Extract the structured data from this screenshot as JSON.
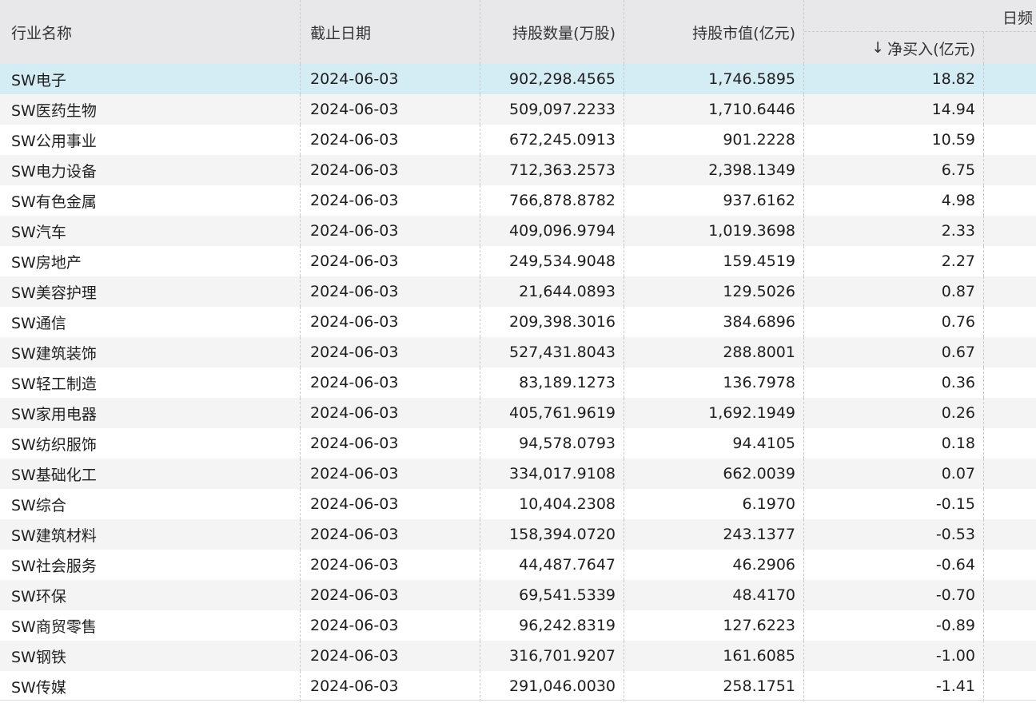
{
  "header": {
    "industry": "行业名称",
    "date": "截止日期",
    "shares": "持股数量(万股)",
    "value": "持股市值(亿元)",
    "group_title": "日频",
    "net_buy": "净买入(亿元)",
    "sort_icon": "↓"
  },
  "rows": [
    {
      "industry": "SW电子",
      "date": "2024-06-03",
      "shares": "902,298.4565",
      "value": "1,746.5895",
      "net": "18.82"
    },
    {
      "industry": "SW医药生物",
      "date": "2024-06-03",
      "shares": "509,097.2233",
      "value": "1,710.6446",
      "net": "14.94"
    },
    {
      "industry": "SW公用事业",
      "date": "2024-06-03",
      "shares": "672,245.0913",
      "value": "901.2228",
      "net": "10.59"
    },
    {
      "industry": "SW电力设备",
      "date": "2024-06-03",
      "shares": "712,363.2573",
      "value": "2,398.1349",
      "net": "6.75"
    },
    {
      "industry": "SW有色金属",
      "date": "2024-06-03",
      "shares": "766,878.8782",
      "value": "937.6162",
      "net": "4.98"
    },
    {
      "industry": "SW汽车",
      "date": "2024-06-03",
      "shares": "409,096.9794",
      "value": "1,019.3698",
      "net": "2.33"
    },
    {
      "industry": "SW房地产",
      "date": "2024-06-03",
      "shares": "249,534.9048",
      "value": "159.4519",
      "net": "2.27"
    },
    {
      "industry": "SW美容护理",
      "date": "2024-06-03",
      "shares": "21,644.0893",
      "value": "129.5026",
      "net": "0.87"
    },
    {
      "industry": "SW通信",
      "date": "2024-06-03",
      "shares": "209,398.3016",
      "value": "384.6896",
      "net": "0.76"
    },
    {
      "industry": "SW建筑装饰",
      "date": "2024-06-03",
      "shares": "527,431.8043",
      "value": "288.8001",
      "net": "0.67"
    },
    {
      "industry": "SW轻工制造",
      "date": "2024-06-03",
      "shares": "83,189.1273",
      "value": "136.7978",
      "net": "0.36"
    },
    {
      "industry": "SW家用电器",
      "date": "2024-06-03",
      "shares": "405,761.9619",
      "value": "1,692.1949",
      "net": "0.26"
    },
    {
      "industry": "SW纺织服饰",
      "date": "2024-06-03",
      "shares": "94,578.0793",
      "value": "94.4105",
      "net": "0.18"
    },
    {
      "industry": "SW基础化工",
      "date": "2024-06-03",
      "shares": "334,017.9108",
      "value": "662.0039",
      "net": "0.07"
    },
    {
      "industry": "SW综合",
      "date": "2024-06-03",
      "shares": "10,404.2308",
      "value": "6.1970",
      "net": "-0.15"
    },
    {
      "industry": "SW建筑材料",
      "date": "2024-06-03",
      "shares": "158,394.0720",
      "value": "243.1377",
      "net": "-0.53"
    },
    {
      "industry": "SW社会服务",
      "date": "2024-06-03",
      "shares": "44,487.7647",
      "value": "46.2906",
      "net": "-0.64"
    },
    {
      "industry": "SW环保",
      "date": "2024-06-03",
      "shares": "69,541.5339",
      "value": "48.4170",
      "net": "-0.70"
    },
    {
      "industry": "SW商贸零售",
      "date": "2024-06-03",
      "shares": "96,242.8319",
      "value": "127.6223",
      "net": "-0.89"
    },
    {
      "industry": "SW钢铁",
      "date": "2024-06-03",
      "shares": "316,701.9207",
      "value": "161.6085",
      "net": "-1.00"
    },
    {
      "industry": "SW传媒",
      "date": "2024-06-03",
      "shares": "291,046.0030",
      "value": "258.1751",
      "net": "-1.41"
    }
  ],
  "colors": {
    "header_bg": "#e8e8ea",
    "row_alt_bg": "#f4f4f4",
    "selected_row_bg": "#d4ecf4"
  }
}
